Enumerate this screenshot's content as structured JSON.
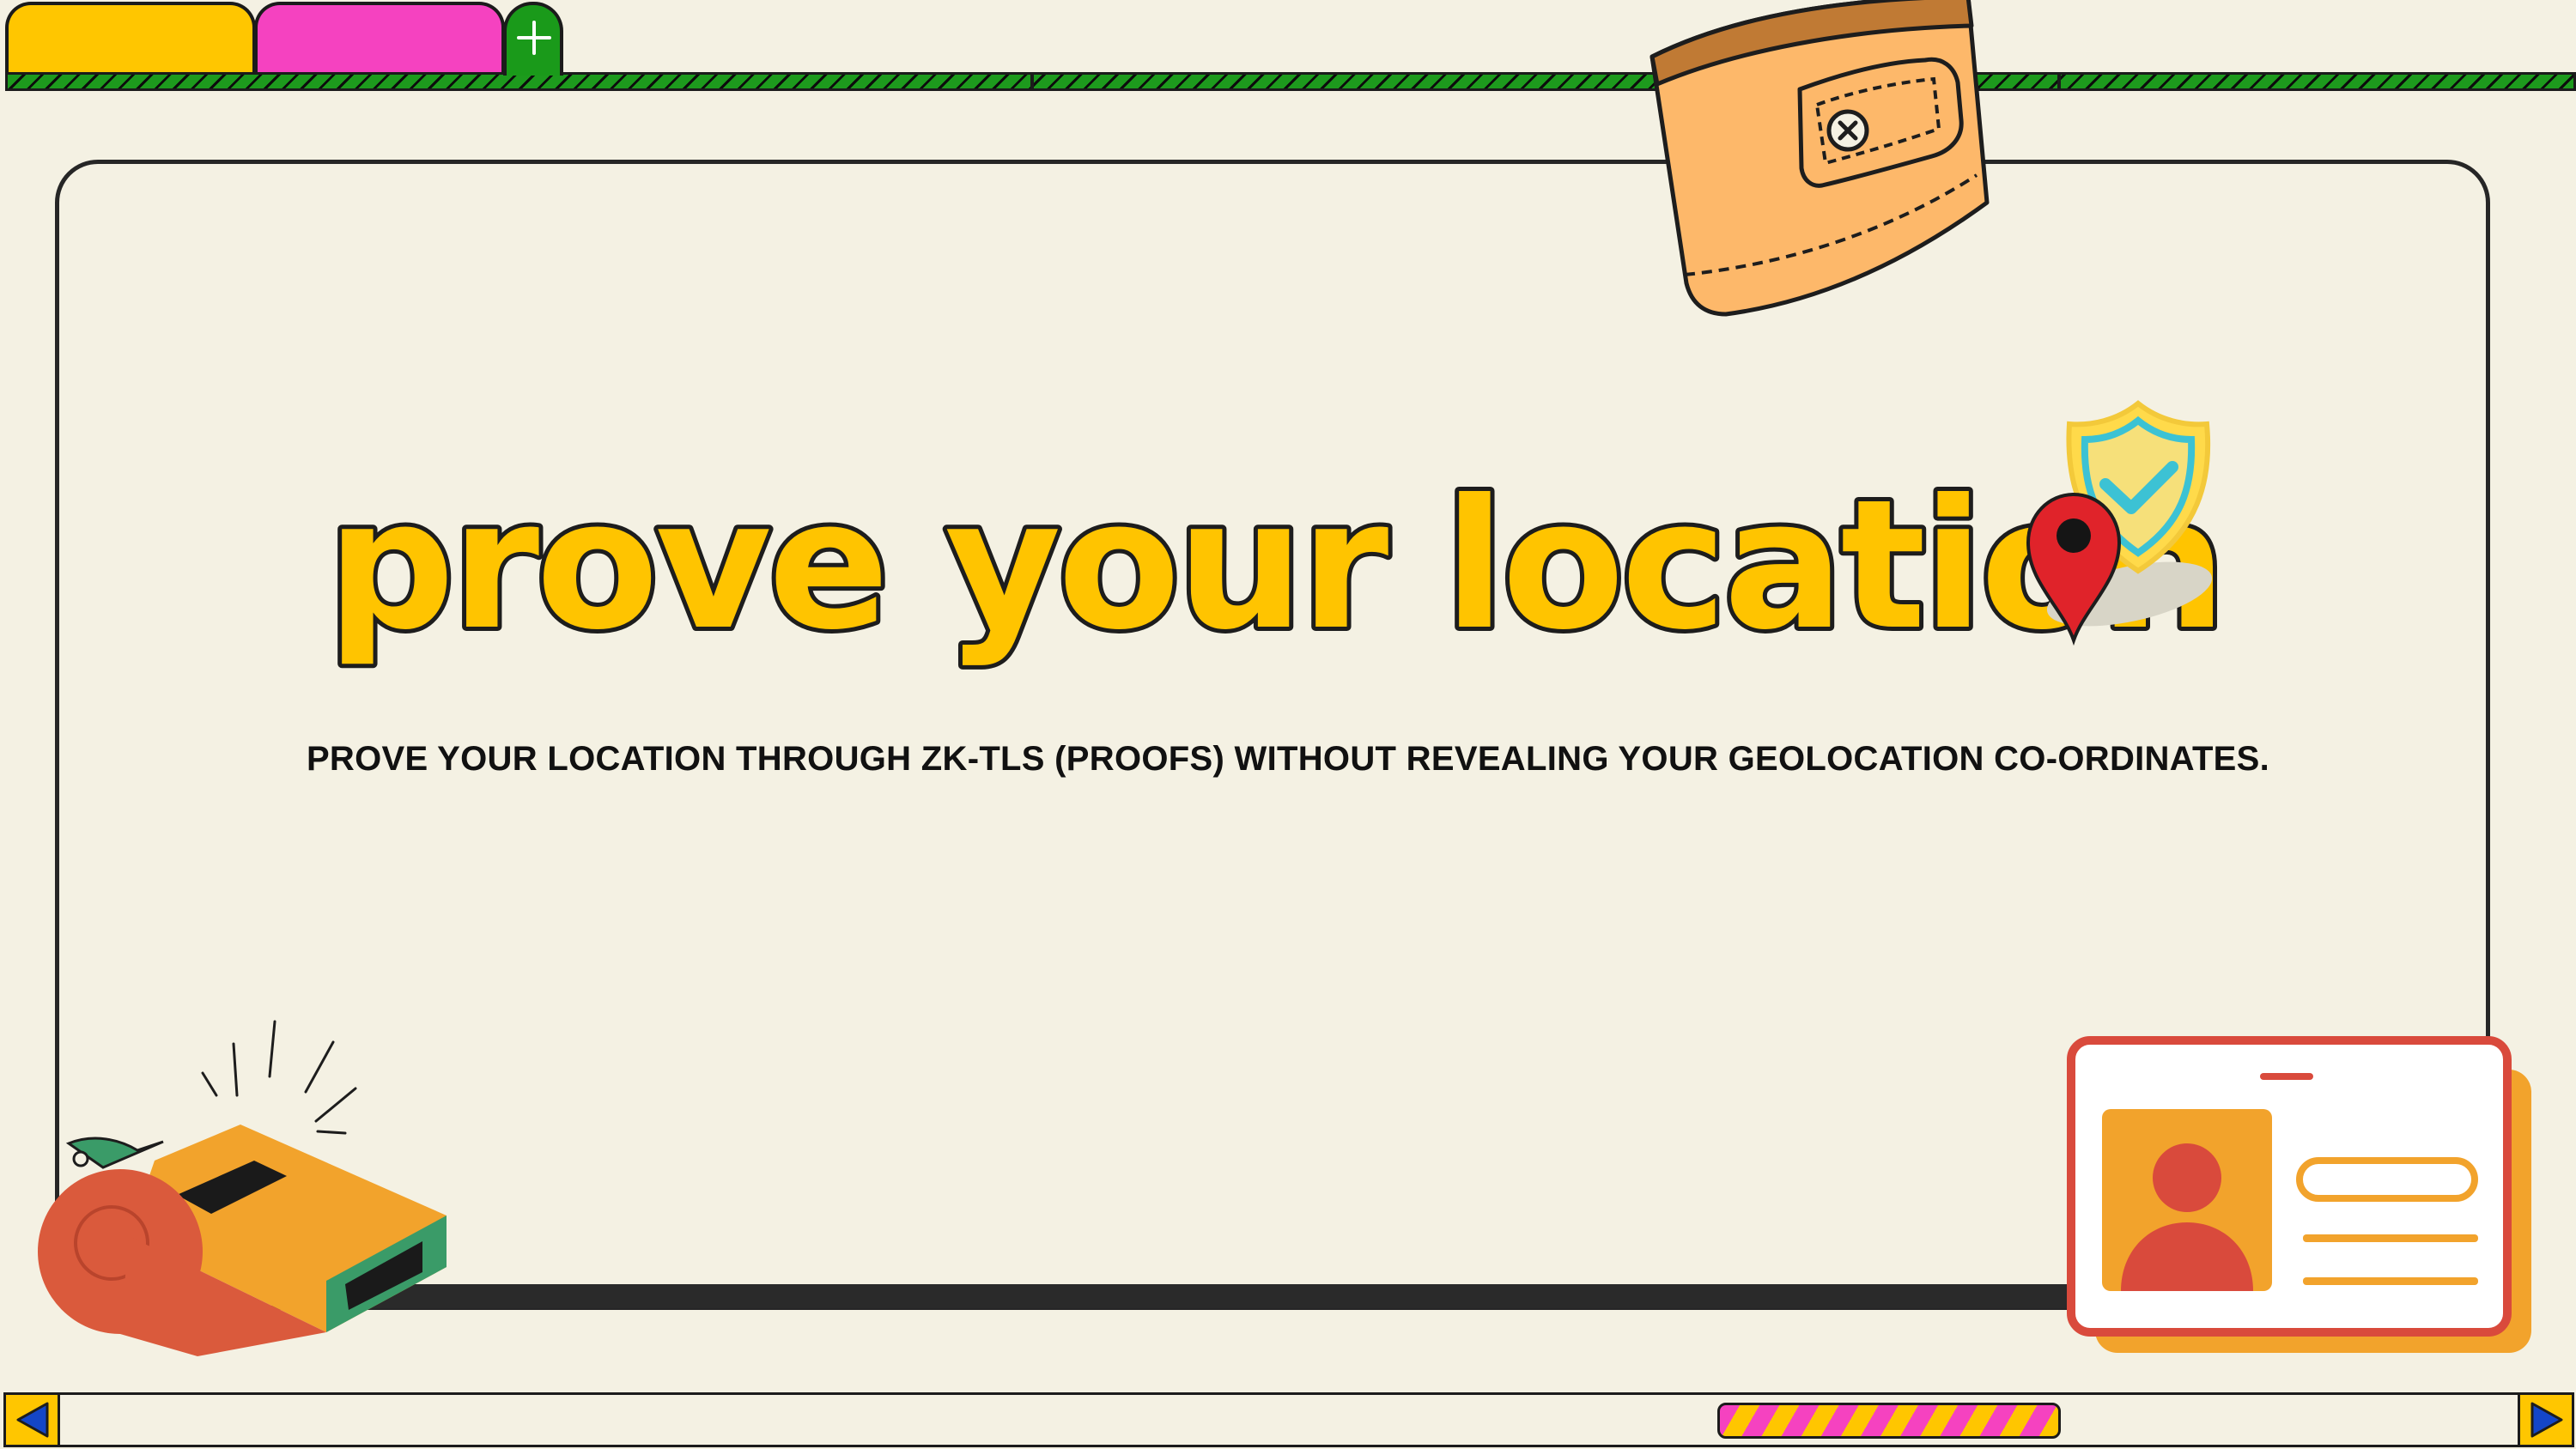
{
  "tabs": [
    {
      "label": "",
      "color": "#FFC600"
    },
    {
      "label": "",
      "color": "#F542C0"
    }
  ],
  "new_tab": {
    "icon": "plus-icon",
    "color": "#1A9A1A"
  },
  "main": {
    "title": "prove your location",
    "subtitle": "PROVE YOUR LOCATION THROUGH ZK-TLS (PROOFS) WITHOUT REVEALING YOUR GEOLOCATION CO-ORDINATES."
  },
  "stickers": [
    "wallet-icon",
    "location-pin-icon",
    "verified-shield-icon",
    "whistle-icon",
    "id-card-icon"
  ],
  "scrollbar": {
    "left_icon": "arrow-left-icon",
    "right_icon": "arrow-right-icon"
  },
  "colors": {
    "background": "#F4F1E3",
    "accent_yellow": "#FFC400",
    "accent_pink": "#F542C0",
    "accent_green": "#1D9A1D",
    "arrow_blue": "#1446C8"
  }
}
